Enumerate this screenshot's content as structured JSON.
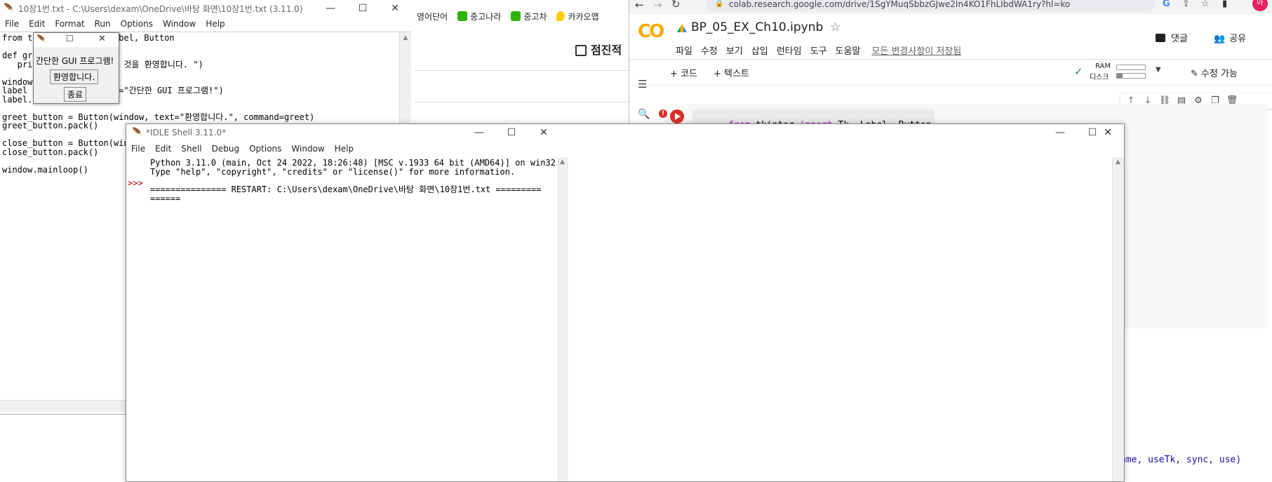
{
  "editor": {
    "title": "10장1번.txt - C:\\Users\\dexam\\OneDrive\\바탕 화면\\10장1번.txt (3.11.0)",
    "menu": [
      "File",
      "Edit",
      "Format",
      "Run",
      "Options",
      "Window",
      "Help"
    ],
    "code": "from tk              Label, Button\n\ndef gre\n   pri                  것을 환영합니다. \")\n\nwindow\nlabel =              xt=\"간단한 GUI 프로그램!\")\nlabel.p\n\ngreet_button = Button(window, text=\"환영합니다.\", command=greet)\ngreet_button.pack()\n\nclose_button = Button(win\nclose_button.pack()\n\nwindow.mainloop()"
  },
  "tk_popup": {
    "label": "간단한 GUI 프로그램!",
    "greet_button": "환영합니다.",
    "close_button": "종료"
  },
  "browser_bg": {
    "bookmarks": [
      "영어단어",
      "중고나라",
      "중고차",
      "카카오맵"
    ],
    "heading": "점진적"
  },
  "colab": {
    "url": "colab.research.google.com/drive/1SgYMuqSbbzGJwe2In4KO1FhLIbdWA1ry?hl=ko",
    "logo": "CO",
    "notebook_title": "BP_05_EX_Ch10.ipynb",
    "menu": [
      "파일",
      "수정",
      "보기",
      "삽입",
      "런타임",
      "도구",
      "도움말"
    ],
    "save_status": "모든 변경사항이 저장됨",
    "comment_label": "댓글",
    "share_label": "공유",
    "add_code": "+ 코드",
    "add_text": "+ 텍스트",
    "ram_label": "RAM",
    "disk_label": "디스크",
    "edit_mode": "수정 가능",
    "cell_code_kw1": "from",
    "cell_code_mod": " tkinter ",
    "cell_code_kw2": "import",
    "cell_code_rest": " Tk, Label, Button",
    "traceback_tail": "ame, useTk, sync, use)",
    "avatar_initial": "아"
  },
  "idle_shell": {
    "title": "*IDLE Shell 3.11.0*",
    "menu": [
      "File",
      "Edit",
      "Shell",
      "Debug",
      "Options",
      "Window",
      "Help"
    ],
    "prompt": ">>>",
    "line1": "Python 3.11.0 (main, Oct 24 2022, 18:26:48) [MSC v.1933 64 bit (AMD64)] on win32",
    "line2": "Type \"help\", \"copyright\", \"credits\" or \"license()\" for more information.",
    "line3": "=============== RESTART: C:\\Users\\dexam\\OneDrive\\바탕 화면\\10장1번.txt =========",
    "line4": "======"
  },
  "colors": {
    "colab_orange": "#f9ab00",
    "run_red": "#d93025",
    "link_blue": "#1a0dab",
    "keyword_purple": "#9c27b0"
  }
}
